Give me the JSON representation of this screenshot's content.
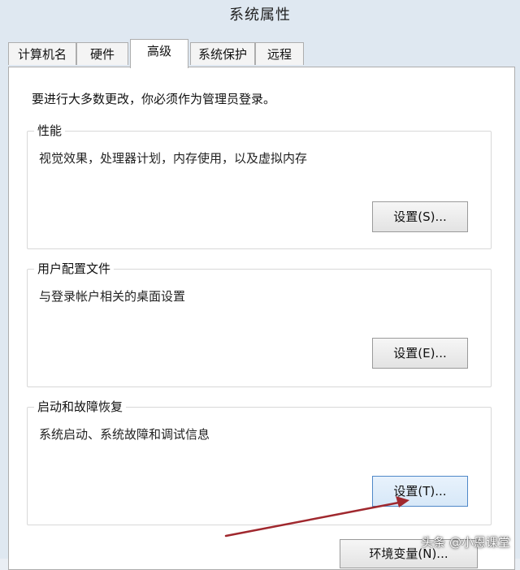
{
  "window": {
    "title": "系统属性"
  },
  "tabs": [
    {
      "label": "计算机名",
      "active": false
    },
    {
      "label": "硬件",
      "active": false
    },
    {
      "label": "高级",
      "active": true
    },
    {
      "label": "系统保护",
      "active": false
    },
    {
      "label": "远程",
      "active": false
    }
  ],
  "advanced": {
    "intro": "要进行大多数更改，你必须作为管理员登录。",
    "performance": {
      "title": "性能",
      "description": "视觉效果，处理器计划，内存使用，以及虚拟内存",
      "button_label": "设置(S)..."
    },
    "user_profiles": {
      "title": "用户配置文件",
      "description": "与登录帐户相关的桌面设置",
      "button_label": "设置(E)..."
    },
    "startup_recovery": {
      "title": "启动和故障恢复",
      "description": "系统启动、系统故障和调试信息",
      "button_label": "设置(T)..."
    },
    "env_button_label": "环境变量(N)..."
  },
  "overlay": {
    "watermark": "头条 @小恩课堂",
    "arrow_color": "#a0282e"
  }
}
